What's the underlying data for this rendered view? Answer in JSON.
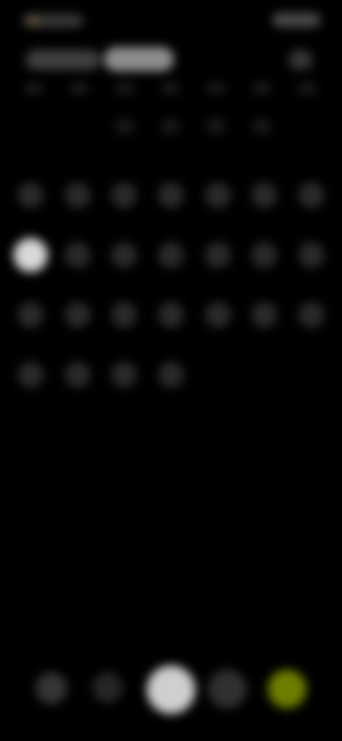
{
  "screen": {
    "background": "#000000",
    "accent": "#6e7d00",
    "selected_fill": "#d8d8d8"
  },
  "status_bar": {
    "time": "",
    "icons": [
      "signal-icon",
      "battery-icon"
    ]
  },
  "header": {
    "month_label": "",
    "year_label": "",
    "menu_icon": "menu-icon"
  },
  "weekdays": [
    "",
    "",
    "",
    "",
    "",
    "",
    ""
  ],
  "calendar": {
    "selected_index": 7,
    "cells": [
      {
        "label": ""
      },
      {
        "label": ""
      },
      {
        "label": ""
      },
      {
        "label": ""
      },
      {
        "label": ""
      },
      {
        "label": ""
      },
      {
        "label": ""
      },
      {
        "label": ""
      },
      {
        "label": ""
      },
      {
        "label": ""
      },
      {
        "label": ""
      },
      {
        "label": ""
      },
      {
        "label": ""
      },
      {
        "label": ""
      },
      {
        "label": ""
      },
      {
        "label": ""
      },
      {
        "label": ""
      },
      {
        "label": ""
      },
      {
        "label": ""
      },
      {
        "label": ""
      },
      {
        "label": ""
      },
      {
        "label": ""
      },
      {
        "label": ""
      },
      {
        "label": ""
      },
      {
        "label": ""
      }
    ]
  },
  "bottom_nav": {
    "items": [
      {
        "icon": "home-icon"
      },
      {
        "icon": "calendar-icon"
      },
      {
        "icon": "add-icon"
      },
      {
        "icon": "profile-icon"
      },
      {
        "icon": "settings-icon"
      }
    ]
  }
}
